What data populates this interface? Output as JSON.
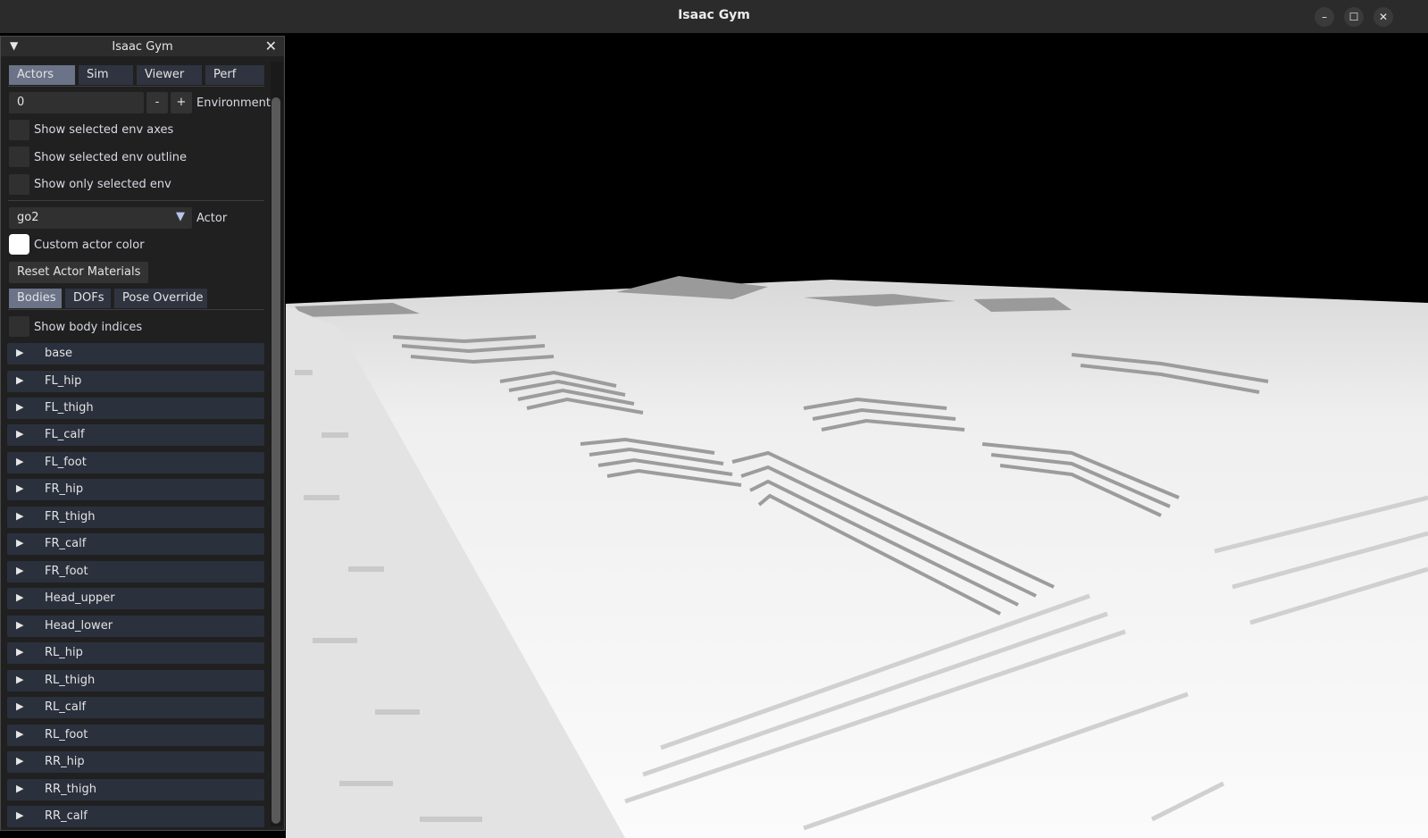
{
  "window": {
    "title": "Isaac Gym",
    "buttons": {
      "minimize": "–",
      "maximize": "☐",
      "close": "✕"
    }
  },
  "panel": {
    "title": "Isaac Gym",
    "collapse_glyph": "▼",
    "close_glyph": "✕",
    "top_tabs": [
      "Actors",
      "Sim",
      "Viewer",
      "Perf"
    ],
    "active_top_tab": "Actors",
    "env": {
      "value": "0",
      "minus": "-",
      "plus": "+",
      "label": "Environment"
    },
    "env_checks": [
      {
        "label": "Show selected env axes",
        "checked": false
      },
      {
        "label": "Show selected env outline",
        "checked": false
      },
      {
        "label": "Show only selected env",
        "checked": false
      }
    ],
    "actor": {
      "value": "go2",
      "arrow": "▼",
      "label": "Actor"
    },
    "custom_color": {
      "label": "Custom actor color"
    },
    "reset_button": "Reset Actor Materials",
    "sub_tabs": [
      "Bodies",
      "DOFs",
      "Pose Override"
    ],
    "active_sub_tab": "Bodies",
    "show_body_indices": {
      "label": "Show body indices",
      "checked": false
    },
    "tree_arrow": "▶",
    "bodies": [
      "base",
      "FL_hip",
      "FL_thigh",
      "FL_calf",
      "FL_foot",
      "FR_hip",
      "FR_thigh",
      "FR_calf",
      "FR_foot",
      "Head_upper",
      "Head_lower",
      "RL_hip",
      "RL_thigh",
      "RL_calf",
      "RL_foot",
      "RR_hip",
      "RR_thigh",
      "RR_calf"
    ]
  },
  "icons": {
    "collapse": "triangle-down-icon",
    "close": "close-icon",
    "tree_node": "triangle-right-icon",
    "combo": "chevron-down-icon"
  },
  "colors": {
    "panel_bg": "#202020",
    "active_tab": "#6a7387",
    "tab": "#2f3440",
    "tree_row": "#2b303d",
    "terrain": "#f2f2f2",
    "sky": "#000000"
  }
}
